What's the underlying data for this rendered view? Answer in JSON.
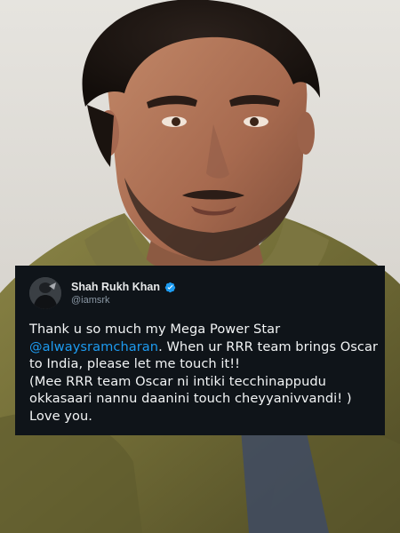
{
  "tweet": {
    "display_name": "Shah Rukh Khan",
    "handle": "@iamsrk",
    "verified_icon": "verified-badge-icon",
    "avatar_icon": "profile-photo",
    "line1": "Thank u so much my Mega Power Star",
    "mention": "@alwaysramcharan",
    "line2_rest": ". When ur RRR team brings Oscar",
    "line3": "to India, please let me touch it!!",
    "line4": "(Mee RRR team Oscar ni intiki tecchinappudu",
    "line5": "okkasaari nannu daanini touch cheyyanivvandi! )",
    "line6": "Love you.",
    "colors": {
      "card_background": "#0f1419",
      "text": "#f2f4f5",
      "mention": "#1d9bf0",
      "handle": "#8b98a5",
      "verified": "#1d9bf0"
    }
  }
}
